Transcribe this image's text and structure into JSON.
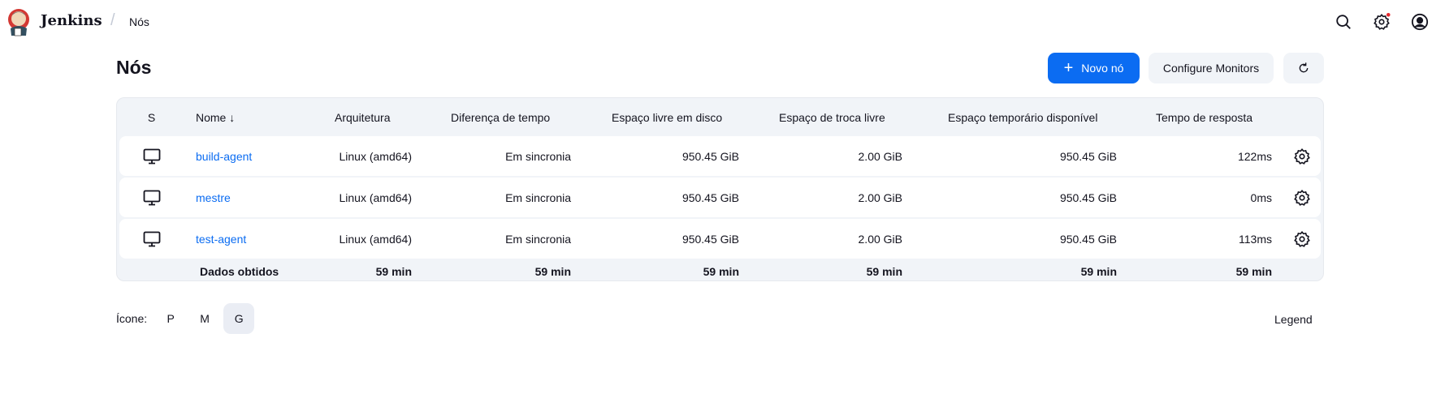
{
  "header": {
    "brand": "Jenkins",
    "breadcrumb": "Nós",
    "icons": [
      "search-icon",
      "gear-icon",
      "user-icon"
    ],
    "notification_color": "#e5282d"
  },
  "page": {
    "title": "Nós",
    "new_node": "Novo nó",
    "configure_monitors": "Configure Monitors",
    "accent": "#0b6cf2"
  },
  "table": {
    "headers": [
      "S",
      "Nome ↓",
      "Arquitetura",
      "Diferença de tempo",
      "Espaço livre em disco",
      "Espaço de troca livre",
      "Espaço temporário disponível",
      "Tempo de resposta"
    ],
    "rows": [
      {
        "name": "build-agent",
        "arch": "Linux (amd64)",
        "clock": "Em sincronia",
        "disk": "950.45 GiB",
        "swap": "2.00 GiB",
        "temp": "950.45 GiB",
        "response": "122ms"
      },
      {
        "name": "mestre",
        "arch": "Linux (amd64)",
        "clock": "Em sincronia",
        "disk": "950.45 GiB",
        "swap": "2.00 GiB",
        "temp": "950.45 GiB",
        "response": "0ms"
      },
      {
        "name": "test-agent",
        "arch": "Linux (amd64)",
        "clock": "Em sincronia",
        "disk": "950.45 GiB",
        "swap": "2.00 GiB",
        "temp": "950.45 GiB",
        "response": "113ms"
      }
    ],
    "footer": {
      "label": "Dados obtidos",
      "values": [
        "59 min",
        "59 min",
        "59 min",
        "59 min",
        "59 min",
        "59 min"
      ]
    }
  },
  "icon_size": {
    "label": "Ícone:",
    "options": [
      "P",
      "M",
      "G"
    ],
    "selected": "G"
  },
  "legend": "Legend"
}
